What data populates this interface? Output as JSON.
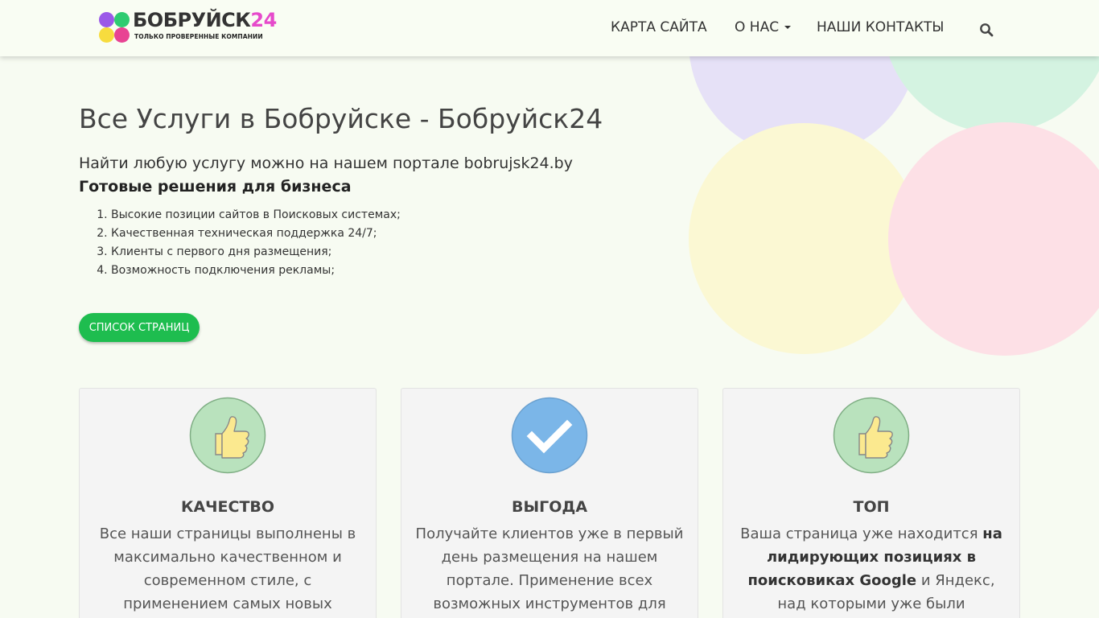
{
  "header": {
    "logo": {
      "name": "БОБРУЙСК",
      "number": "24",
      "tagline": "ТОЛЬКО ПРОВЕРЕННЫЕ КОМПАНИИ",
      "dot_colors": [
        "#9b59e8",
        "#2ecc71",
        "#f7dc3e",
        "#e84393"
      ]
    },
    "nav": {
      "sitemap": "КАРТА САЙТА",
      "about": "О НАС",
      "contacts": "НАШИ КОНТАКТЫ",
      "search_icon": "search-icon"
    }
  },
  "hero": {
    "title": "Все Услуги в Бобруйске - Бобруйск24",
    "subtitle": "Найти любую услугу можно на нашем портале bobrujsk24.by",
    "bold_line": "Готовые решения для бизнеса",
    "list": [
      "Высокие позиции сайтов в Поисковых системах;",
      "Качественная техническая поддержка 24/7;",
      "Клиенты с первого дня размещения;",
      "Возможность подключения рекламы;"
    ],
    "button": "Список страниц"
  },
  "features": [
    {
      "icon": "thumbs-up-icon",
      "title": "Качество",
      "text": "Все наши страницы выполнены в максимально качественном и современном стиле, с применением самых новых технологий разработки"
    },
    {
      "icon": "checkmark-icon",
      "title": "Выгода",
      "text": "Получайте клиентов уже в первый день размещения на нашем портале. Применение всех возможных инструментов для продвижения"
    },
    {
      "icon": "thumbs-up-icon",
      "title": "Топ",
      "text_before": "Ваша страница уже находится ",
      "text_bold": "на лидирующих позициях в поисковиках Google",
      "text_after": " и Яндекс, над которыми уже были произведены"
    }
  ],
  "colors": {
    "button_green": "#1ebd4f",
    "icon_green": "#b9e2bd",
    "icon_blue": "#7bb6e8",
    "bubble_purple": "#e6e1f7",
    "bubble_mint": "#d4f3e1",
    "bubble_yellow": "#fbf8d3",
    "bubble_pink": "#fde0e6"
  }
}
